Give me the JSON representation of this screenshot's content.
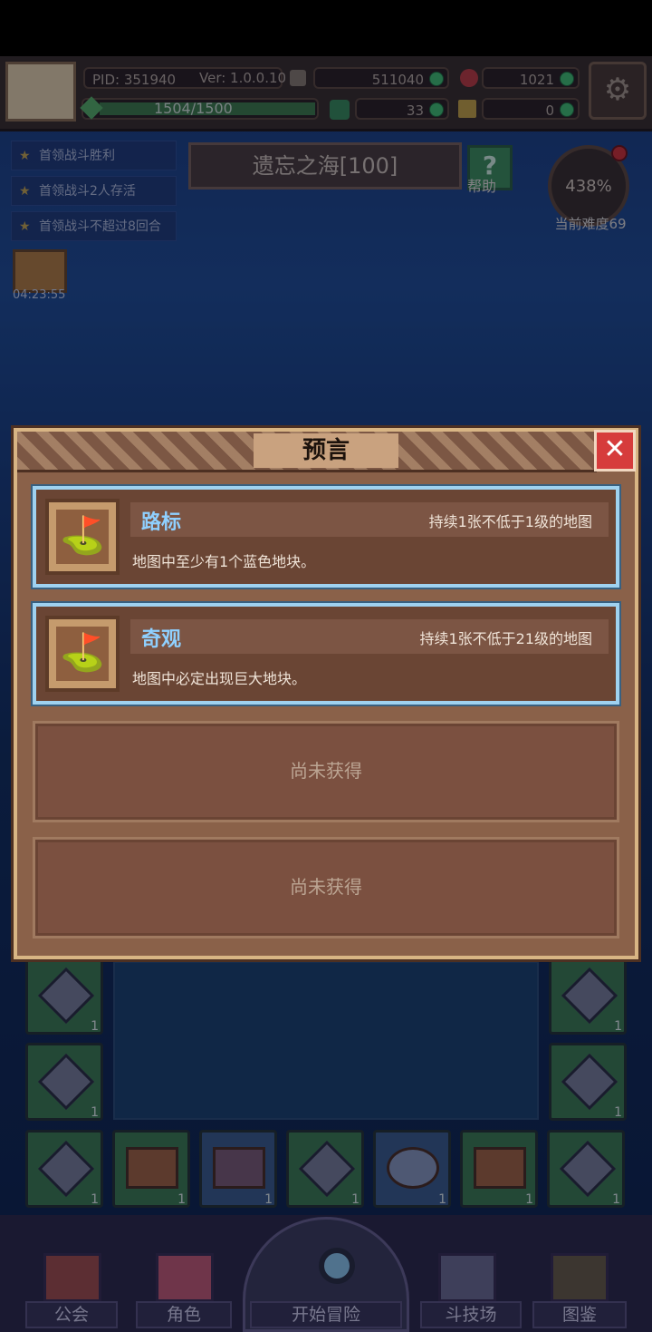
{
  "hud": {
    "pid": "PID: 351940",
    "version": "Ver: 1.0.0.10",
    "gold": "511040",
    "gems": "1021",
    "energy": "1504/1500",
    "clover": "33",
    "keys": "0"
  },
  "quests": [
    "首领战斗胜利",
    "首领战斗2人存活",
    "首领战斗不超过8回合"
  ],
  "timer": "04:23:55",
  "region": "遗忘之海[100]",
  "help_label": "帮助",
  "difficulty": {
    "percent": "438%",
    "label": "当前难度69"
  },
  "dialog": {
    "title": "预言",
    "cards": [
      {
        "name": "路标",
        "condition": "持续1张不低于1级的地图",
        "description": "地图中至少有1个蓝色地块。"
      },
      {
        "name": "奇观",
        "condition": "持续1张不低于21级的地图",
        "description": "地图中必定出现巨大地块。"
      }
    ],
    "empty_slots": [
      "尚未获得",
      "尚未获得"
    ]
  },
  "inventory": {
    "count": "1"
  },
  "nav": {
    "guild": "公会",
    "character": "角色",
    "start": "开始冒险",
    "arena": "斗技场",
    "codex": "图鉴"
  },
  "colors": {
    "accent": "#8fd0ff",
    "close": "#d63c3c",
    "dialog_bg": "#8a6149"
  },
  "icons": {
    "settings": "gear-icon",
    "close": "close-icon",
    "signpost": "signpost-icon",
    "help": "question-icon"
  }
}
